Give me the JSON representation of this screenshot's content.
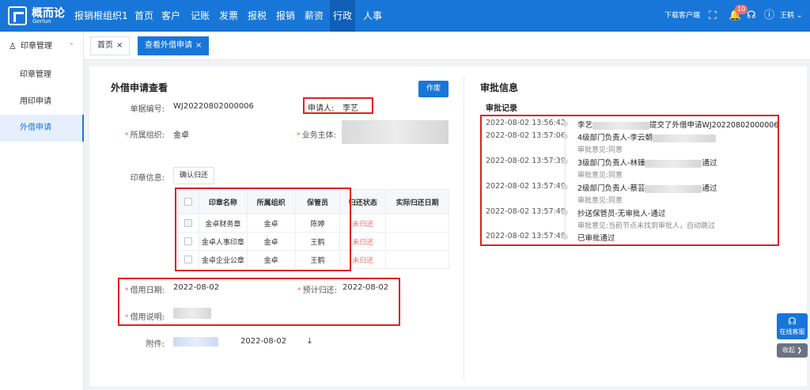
{
  "app": {
    "logo_name": "概而论",
    "logo_sub": "Gerlun",
    "org": "报销根组织1",
    "nav": [
      "首页",
      "客户",
      "记账",
      "发票",
      "报税",
      "报销",
      "薪资",
      "行政",
      "人事"
    ],
    "active_nav": "行政",
    "download_client": "下载客户端",
    "notification_count": "10",
    "user": "王鹤"
  },
  "icons": {
    "scan": "scan-icon",
    "bell": "bell-icon",
    "headset": "headset-icon",
    "help": "help-icon",
    "chevron": "chevron-down-icon",
    "seal": "seal-icon",
    "download": "download-icon"
  },
  "sidebar": {
    "group": "印章管理",
    "items": [
      {
        "label": "印章管理",
        "active": false
      },
      {
        "label": "用印申请",
        "active": false
      },
      {
        "label": "外借申请",
        "active": true
      }
    ]
  },
  "tabs": [
    {
      "label": "首页",
      "close": "×",
      "active": false
    },
    {
      "label": "查看外借申请",
      "close": "×",
      "active": true
    }
  ],
  "form": {
    "title": "外借申请查看",
    "void_button": "作废",
    "doc_no_label": "单据编号:",
    "doc_no": "WJ20220802000006",
    "applicant_label": "申请人:",
    "applicant": "李艺",
    "org_label": "所属组织:",
    "org": "金卓",
    "entity_label": "业务主体:",
    "seal_info_label": "印章信息:",
    "confirm_return_button": "确认归还",
    "borrow_date_label": "借用日期:",
    "borrow_date": "2022-08-02",
    "expected_return_label": "预计归还:",
    "expected_return": "2022-08-02",
    "borrow_note_label": "借用说明:",
    "attachment_label": "附件:",
    "attachment_date": "2022-08-02"
  },
  "seal_table": {
    "headers": [
      "印章名称",
      "所属组织",
      "保管员",
      "归还状态",
      "实际归还日期"
    ],
    "rows": [
      {
        "name": "金卓财务章",
        "org": "金卓",
        "keeper": "陈婷",
        "status": "未归还",
        "return_date": ""
      },
      {
        "name": "金卓人事印章",
        "org": "金卓",
        "keeper": "王鹤",
        "status": "未归还",
        "return_date": ""
      },
      {
        "name": "金卓企业公章",
        "org": "金卓",
        "keeper": "王鹤",
        "status": "未归还",
        "return_date": ""
      }
    ]
  },
  "approval": {
    "title": "审批信息",
    "record_title": "审批记录",
    "entries": [
      {
        "time": "2022-08-02 13:56:42",
        "prefix": "李艺",
        "text": "提交了外借申请WJ20220802000006",
        "sub": ""
      },
      {
        "time": "2022-08-02 13:57:06",
        "prefix": "4级部门负责人-李云朝",
        "text": "",
        "sub": "审批意见:同意"
      },
      {
        "time": "2022-08-02 13:57:39",
        "prefix": "3级部门负责人-林臻",
        "text": "通过",
        "sub": "审批意见:同意"
      },
      {
        "time": "2022-08-02 13:57:49",
        "prefix": "2级部门负责人-蔡芸",
        "text": "通过",
        "sub": "审批意见:同意"
      },
      {
        "time": "2022-08-02 13:57:49",
        "prefix": "抄送保管员-无审批人-通过",
        "text": "",
        "sub": "审批意见:当前节点未找到审批人，自动跳过"
      },
      {
        "time": "2022-08-02 13:57:49",
        "prefix": "已审批通过",
        "text": "",
        "sub": ""
      }
    ]
  },
  "floating": {
    "service": "在线客服",
    "collapse": "收起 ❯"
  }
}
